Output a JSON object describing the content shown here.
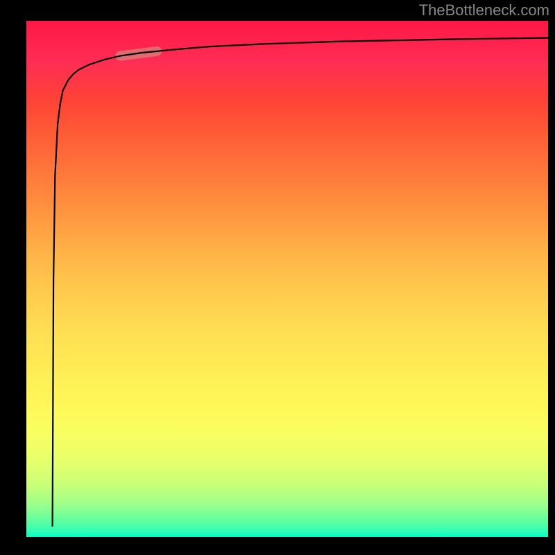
{
  "watermark": "TheBottleneck.com",
  "chart_data": {
    "type": "line",
    "title": "",
    "xlabel": "",
    "ylabel": "",
    "x_range": [
      0,
      100
    ],
    "y_range": [
      0,
      100
    ],
    "series": [
      {
        "name": "curve",
        "x": [
          5.0,
          5.2,
          5.5,
          6.0,
          6.5,
          7.0,
          8.0,
          9.0,
          10.0,
          12.0,
          15.0,
          18.0,
          22.0,
          28.0,
          35.0,
          45.0,
          60.0,
          80.0,
          100.0
        ],
        "y": [
          2.0,
          50.0,
          70.0,
          80.0,
          84.0,
          86.5,
          88.5,
          89.7,
          90.5,
          91.5,
          92.5,
          93.2,
          93.8,
          94.4,
          95.0,
          95.5,
          96.0,
          96.4,
          96.7
        ]
      }
    ],
    "highlight_region": {
      "x_start": 18.0,
      "x_end": 25.0
    },
    "gradient_colors": {
      "top": "#ff1744",
      "middle": "#ffed55",
      "bottom": "#00ffcc"
    }
  }
}
